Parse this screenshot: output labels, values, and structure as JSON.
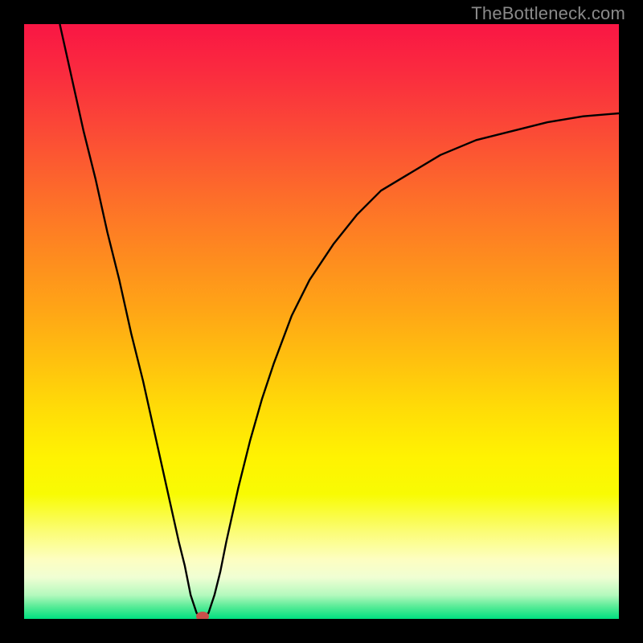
{
  "watermark": "TheBottleneck.com",
  "chart_data": {
    "type": "line",
    "title": "",
    "xlabel": "",
    "ylabel": "",
    "xlim": [
      0,
      100
    ],
    "ylim": [
      0,
      100
    ],
    "series": [
      {
        "name": "curve",
        "x": [
          6,
          8,
          10,
          12,
          14,
          16,
          18,
          20,
          22,
          24,
          26,
          27,
          28,
          29,
          30,
          31,
          32,
          33,
          34,
          36,
          38,
          40,
          42,
          45,
          48,
          52,
          56,
          60,
          65,
          70,
          76,
          82,
          88,
          94,
          100
        ],
        "y": [
          100,
          91,
          82,
          74,
          65,
          57,
          48,
          40,
          31,
          22,
          13,
          9,
          4,
          1,
          0,
          1,
          4,
          8,
          13,
          22,
          30,
          37,
          43,
          51,
          57,
          63,
          68,
          72,
          75,
          78,
          80.5,
          82,
          83.5,
          84.5,
          85
        ]
      }
    ],
    "marker": {
      "x": 30,
      "y": 0,
      "color": "#c84f4a",
      "rx": 8,
      "ry": 6
    },
    "background": {
      "type": "vertical-gradient",
      "stops": [
        {
          "pos": 0.0,
          "color": "#f91644"
        },
        {
          "pos": 0.18,
          "color": "#fb4a36"
        },
        {
          "pos": 0.38,
          "color": "#fe8820"
        },
        {
          "pos": 0.57,
          "color": "#ffc20e"
        },
        {
          "pos": 0.73,
          "color": "#fff302"
        },
        {
          "pos": 0.9,
          "color": "#fdfec1"
        },
        {
          "pos": 1.0,
          "color": "#00e080"
        }
      ]
    }
  }
}
